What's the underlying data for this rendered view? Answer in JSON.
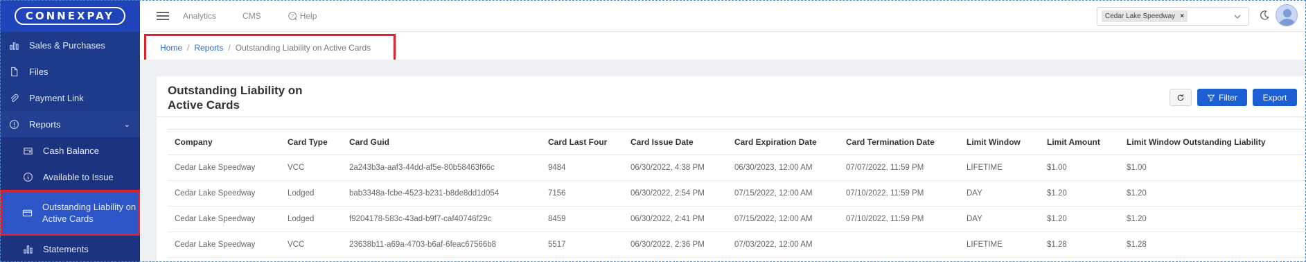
{
  "brand": {
    "logo_text": "CONNEXPAY"
  },
  "sidebar": {
    "items": [
      {
        "label": "Sales & Purchases",
        "icon": "bar-chart-icon"
      },
      {
        "label": "Files",
        "icon": "file-icon"
      },
      {
        "label": "Payment Link",
        "icon": "paperclip-icon"
      },
      {
        "label": "Reports",
        "icon": "info-circle-icon"
      }
    ],
    "sub_items": [
      {
        "label": "Cash Balance",
        "icon": "wallet-icon"
      },
      {
        "label": "Available to Issue",
        "icon": "info-circle-icon"
      },
      {
        "label": "Outstanding Liability on Active Cards",
        "icon": "credit-card-icon"
      },
      {
        "label": "Statements",
        "icon": "bar-chart-icon"
      }
    ],
    "expand_glyph": "⌄"
  },
  "topbar": {
    "nav": [
      "Analytics",
      "CMS",
      "Help"
    ],
    "merchant_chip": "Cedar Lake Speedway",
    "chip_remove": "×"
  },
  "breadcrumb": {
    "home": "Home",
    "reports": "Reports",
    "current": "Outstanding Liability on Active Cards",
    "separator": "/"
  },
  "report": {
    "title": "Outstanding Liability on Active Cards",
    "filter_label": "Filter",
    "export_label": "Export",
    "columns": [
      "Company",
      "Card Type",
      "Card Guid",
      "Card Last Four",
      "Card Issue Date",
      "Card Expiration Date",
      "Card Termination Date",
      "Limit Window",
      "Limit Amount",
      "Limit Window Outstanding Liability"
    ],
    "rows": [
      [
        "Cedar Lake Speedway",
        "VCC",
        "2a243b3a-aaf3-44dd-af5e-80b58463f66c",
        "9484",
        "06/30/2022, 4:38 PM",
        "06/30/2023, 12:00 AM",
        "07/07/2022, 11:59 PM",
        "LIFETIME",
        "$1.00",
        "$1.00"
      ],
      [
        "Cedar Lake Speedway",
        "Lodged",
        "bab3348a-fcbe-4523-b231-b8de8dd1d054",
        "7156",
        "06/30/2022, 2:54 PM",
        "07/15/2022, 12:00 AM",
        "07/10/2022, 11:59 PM",
        "DAY",
        "$1.20",
        "$1.20"
      ],
      [
        "Cedar Lake Speedway",
        "Lodged",
        "f9204178-583c-43ad-b9f7-caf40746f29c",
        "8459",
        "06/30/2022, 2:41 PM",
        "07/15/2022, 12:00 AM",
        "07/10/2022, 11:59 PM",
        "DAY",
        "$1.20",
        "$1.20"
      ],
      [
        "Cedar Lake Speedway",
        "VCC",
        "23638b11-a69a-4703-b6af-6feac67566b8",
        "5517",
        "06/30/2022, 2:36 PM",
        "07/03/2022, 12:00 AM",
        "",
        "LIFETIME",
        "$1.28",
        "$1.28"
      ]
    ]
  },
  "colors": {
    "sidebar": "#1e3a8a",
    "accent": "#1d5fd2",
    "highlight": "#e0202b"
  }
}
